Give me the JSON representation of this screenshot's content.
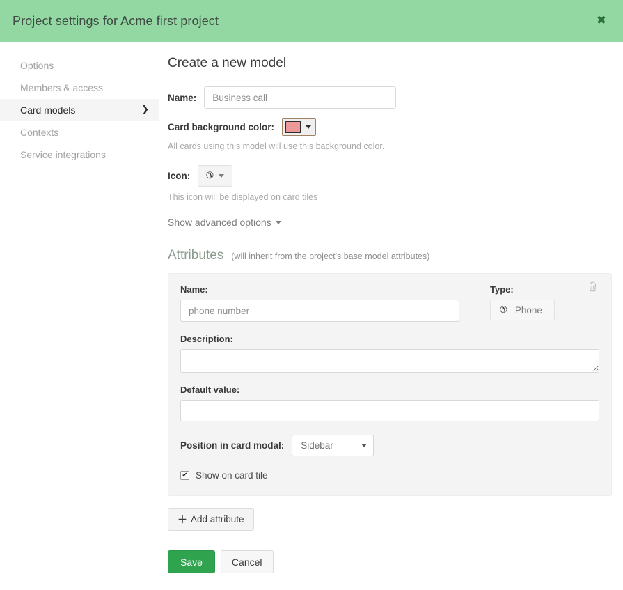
{
  "header": {
    "title": "Project settings for Acme first project",
    "close_glyph": "✖"
  },
  "sidebar": {
    "items": [
      {
        "label": "Options",
        "active": false
      },
      {
        "label": "Members & access",
        "active": false
      },
      {
        "label": "Card models",
        "active": true,
        "chevron": "❯"
      },
      {
        "label": "Contexts",
        "active": false
      },
      {
        "label": "Service integrations",
        "active": false
      }
    ]
  },
  "main": {
    "section_title": "Create a new model",
    "name": {
      "label": "Name:",
      "value": "",
      "placeholder": "Business call"
    },
    "card_background_color": {
      "label": "Card background color:",
      "swatch_hex": "#ee9999",
      "help": "All cards using this model will use this background color."
    },
    "icon": {
      "label": "Icon:",
      "glyph": "✆",
      "help": "This icon will be displayed on card tiles"
    },
    "advanced_toggle": {
      "label": "Show advanced options"
    },
    "attributes": {
      "heading": "Attributes",
      "subnote": "(will inherit from the project's base model attributes)",
      "items": [
        {
          "name_label": "Name:",
          "name_value": "",
          "name_placeholder": "phone number",
          "type_label": "Type:",
          "type_value": "Phone",
          "type_glyph": "✆",
          "delete_glyph": "Ὕ1",
          "description_label": "Description:",
          "description_value": "",
          "default_label": "Default value:",
          "default_value": "",
          "position_label": "Position in card modal:",
          "position_value": "Sidebar",
          "show_on_tile_label": "Show on card tile",
          "show_on_tile_checked": true,
          "check_glyph": "✔"
        }
      ],
      "add_button": {
        "label": "Add attribute",
        "plus_glyph": "＋"
      }
    },
    "footer": {
      "save_label": "Save",
      "cancel_label": "Cancel",
      "save_color": "#2fa34e"
    }
  }
}
